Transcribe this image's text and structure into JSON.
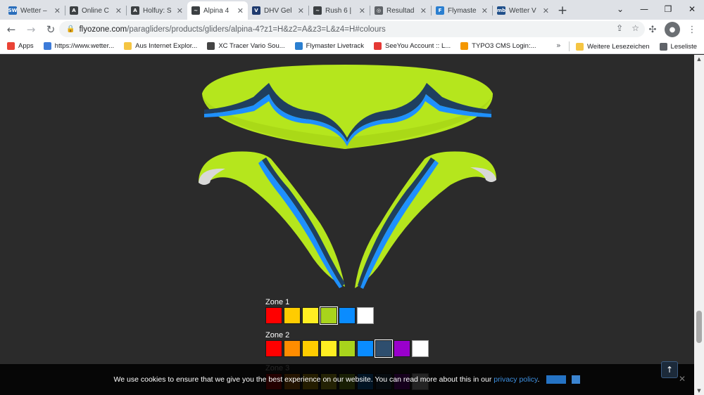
{
  "tabs": [
    {
      "title": "Wetter –",
      "icon": "sw-favicon",
      "color": "#2a6ebb",
      "glyph": "SW",
      "active": false
    },
    {
      "title": "Online C",
      "icon": "xcontest-favicon",
      "color": "#3c4043",
      "glyph": "A",
      "active": false
    },
    {
      "title": "Holfuy: S",
      "icon": "holfuy-favicon",
      "color": "#3c4043",
      "glyph": "A",
      "active": false
    },
    {
      "title": "Alpina 4",
      "icon": "flyozone-favicon",
      "color": "#3c4043",
      "glyph": "~",
      "active": true
    },
    {
      "title": "DHV Gel",
      "icon": "dhv-favicon",
      "color": "#1e3a6e",
      "glyph": "V",
      "active": false
    },
    {
      "title": "Rush 6 |",
      "icon": "flyozone-favicon",
      "color": "#3c4043",
      "glyph": "~",
      "active": false
    },
    {
      "title": "Resultad",
      "icon": "globe-favicon",
      "color": "#5f6368",
      "glyph": "◎",
      "active": false
    },
    {
      "title": "Flymaste",
      "icon": "flymaster-favicon",
      "color": "#2b7fd0",
      "glyph": "F",
      "active": false
    },
    {
      "title": "Wetter V",
      "icon": "mb-favicon",
      "color": "#1f4f8a",
      "glyph": "mb",
      "active": false
    }
  ],
  "toolbar": {
    "url_host": "flyozone.com",
    "url_path": "/paragliders/products/gliders/alpina-4?z1=H&z2=A&z3=L&z4=H#colours"
  },
  "bookmarks": [
    {
      "label": "Apps",
      "icon": "apps-grid-icon",
      "color": "#ea4335"
    },
    {
      "label": "https://www.wetter...",
      "icon": "globe-icon",
      "color": "#3c7bd9"
    },
    {
      "label": "Aus Internet Explor...",
      "icon": "folder-icon",
      "color": "#f5c542"
    },
    {
      "label": "XC Tracer Vario Sou...",
      "icon": "xctracer-icon",
      "color": "#444444"
    },
    {
      "label": "Flymaster Livetrack",
      "icon": "flymaster-icon",
      "color": "#2b7fd0"
    },
    {
      "label": "SeeYou Account :: L...",
      "icon": "seeyou-icon",
      "color": "#e53935"
    },
    {
      "label": "TYPO3 CMS Login:...",
      "icon": "typo3-icon",
      "color": "#f49700"
    }
  ],
  "bookmarks_right": [
    {
      "label": "Weitere Lesezeichen",
      "icon": "folder-icon",
      "color": "#f5c542"
    },
    {
      "label": "Leseliste",
      "icon": "reading-list-icon",
      "color": "#5f6368"
    }
  ],
  "zones": [
    {
      "label": "Zone 1",
      "colors": [
        "#ff0000",
        "#ffcc00",
        "#ffee22",
        "#a8d41c",
        "#0a8cff",
        "#ffffff"
      ],
      "selected": 3
    },
    {
      "label": "Zone 2",
      "colors": [
        "#ff0000",
        "#ff8c00",
        "#ffcc00",
        "#ffee22",
        "#a8d41c",
        "#0a8cff",
        "#2e4e6e",
        "#9900cc",
        "#ffffff"
      ],
      "selected": 6
    },
    {
      "label": "Zone 3",
      "colors": [
        "#ff0000",
        "#ff8c00",
        "#ffcc00",
        "#ffee22",
        "#a8d41c",
        "#0a8cff",
        "#2e4e6e",
        "#9900cc",
        "#ffffff"
      ],
      "selected": -1
    }
  ],
  "cookie": {
    "text": "We use cookies to ensure that we give you the best experience on our website. You can read more about this in our",
    "link": "privacy policy",
    "after": "."
  },
  "colors": {
    "glider_main": "#b5e61d",
    "glider_dark": "#1f3f5f",
    "glider_blue": "#1e90ff"
  }
}
